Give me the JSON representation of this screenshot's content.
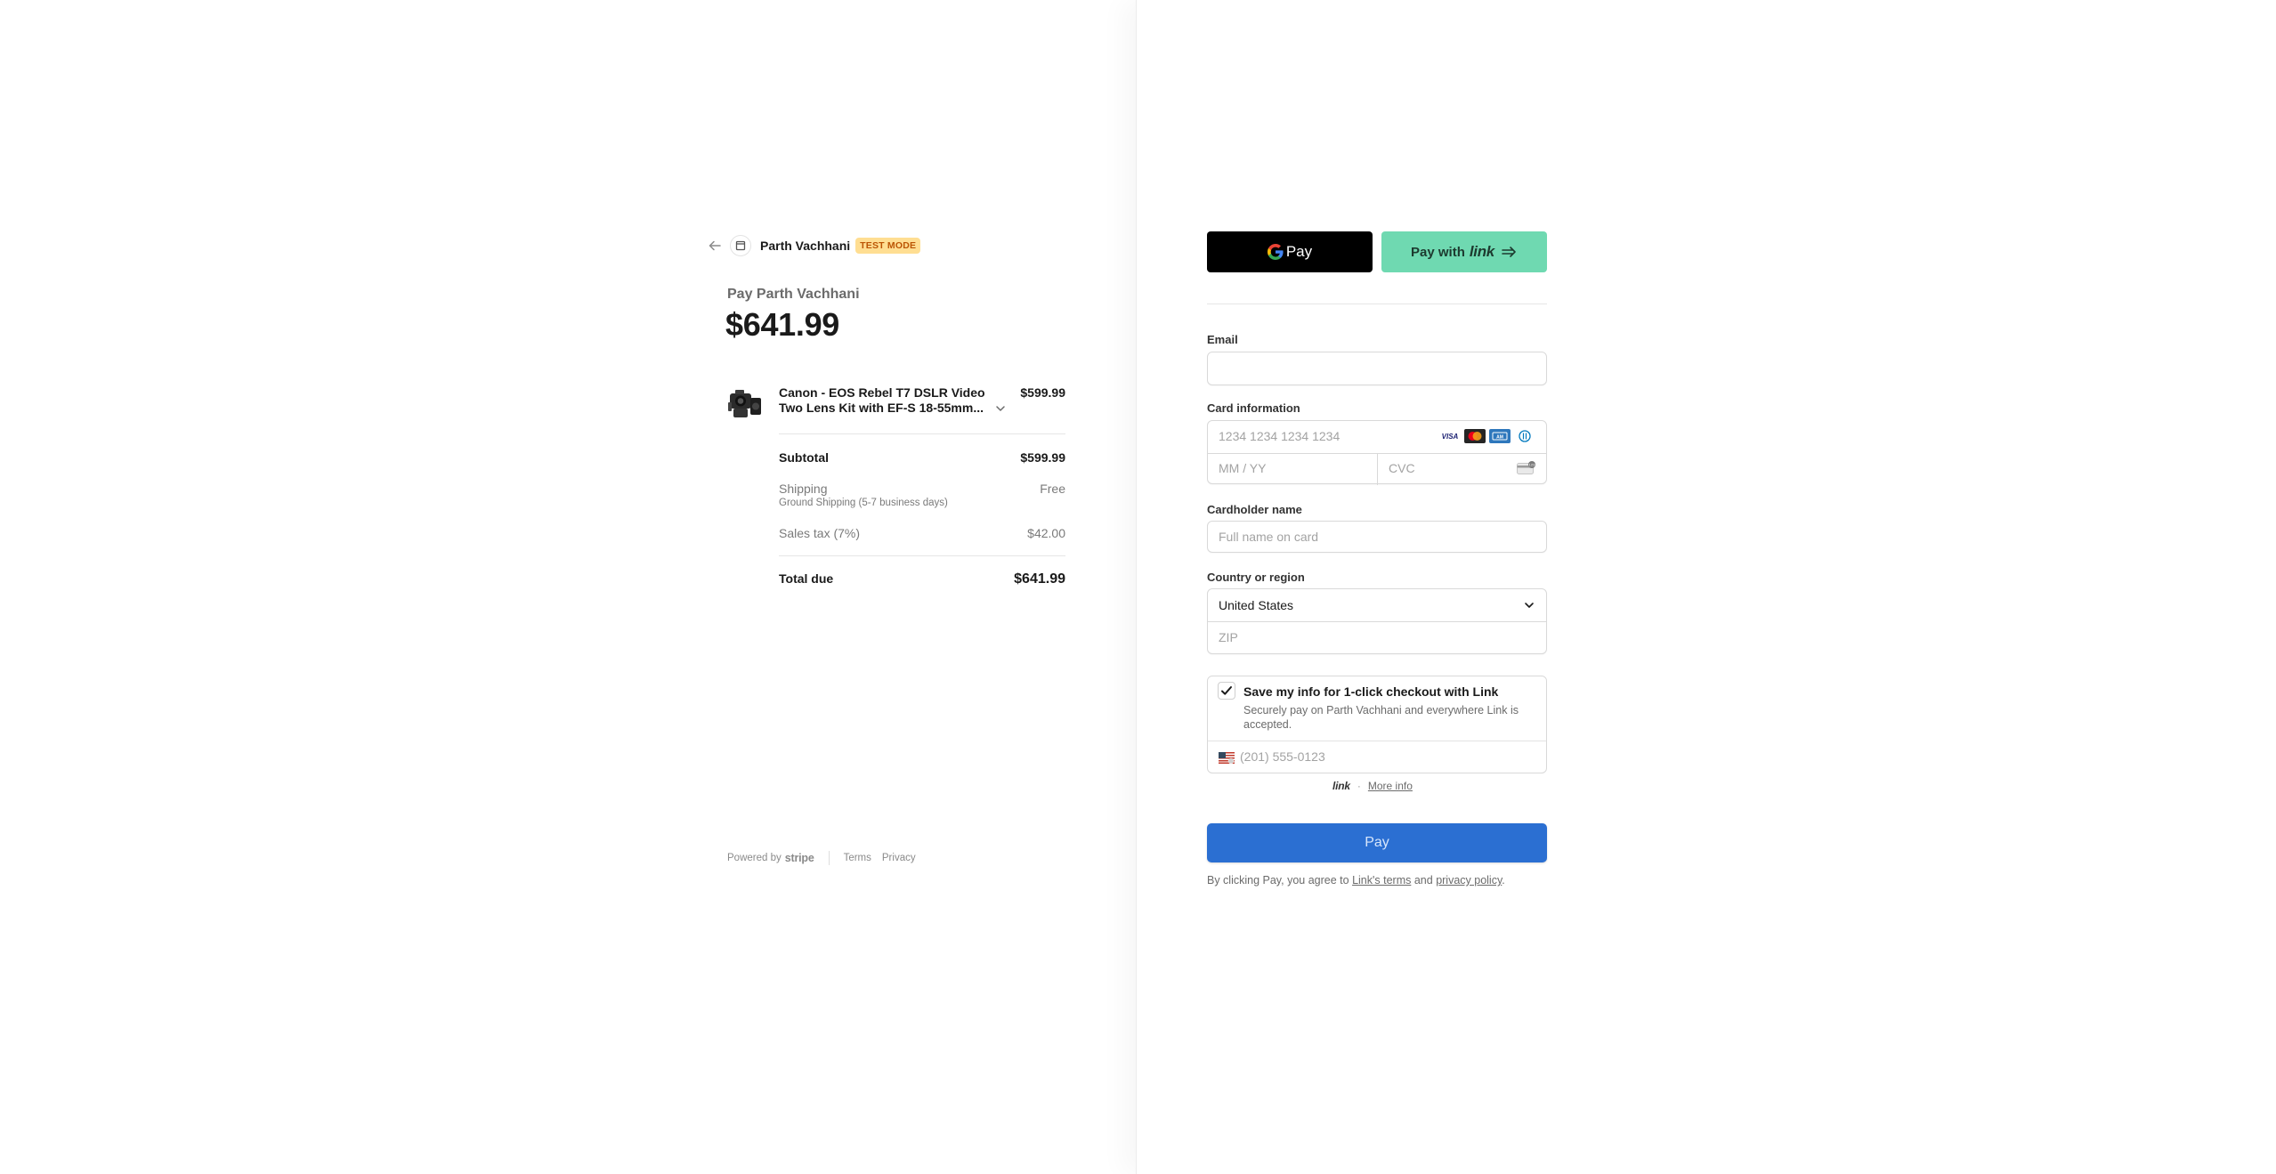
{
  "merchant": {
    "name": "Parth Vachhani",
    "badge": "TEST MODE"
  },
  "summary": {
    "pay_label": "Pay Parth Vachhani",
    "amount": "$641.99",
    "product": {
      "name": "Canon - EOS Rebel T7 DSLR Video Two Lens Kit with EF-S 18-55mm...",
      "price": "$599.99"
    },
    "subtotal_label": "Subtotal",
    "subtotal_value": "$599.99",
    "shipping_label": "Shipping",
    "shipping_value": "Free",
    "shipping_note": "Ground Shipping (5-7 business days)",
    "tax_label": "Sales tax (7%)",
    "tax_value": "$42.00",
    "total_label": "Total due",
    "total_value": "$641.99"
  },
  "footer": {
    "powered_by": "Powered by",
    "stripe": "stripe",
    "terms": "Terms",
    "privacy": "Privacy"
  },
  "wallets": {
    "gpay_label": "Pay",
    "link_prefix": "Pay with",
    "link_word": "link"
  },
  "form": {
    "email_label": "Email",
    "email_value": "",
    "card_label": "Card information",
    "card_number_placeholder": "1234 1234 1234 1234",
    "expiry_placeholder": "MM / YY",
    "cvc_placeholder": "CVC",
    "cardholder_label": "Cardholder name",
    "cardholder_placeholder": "Full name on card",
    "country_label": "Country or region",
    "country_value": "United States",
    "zip_placeholder": "ZIP",
    "card_brands": [
      "visa-icon",
      "mastercard-icon",
      "amex-icon",
      "diners-icon"
    ]
  },
  "link_save": {
    "checked": true,
    "title": "Save my info for 1-click checkout with Link",
    "description": "Securely pay on Parth Vachhani and everywhere Link is accepted.",
    "phone_placeholder": "(201) 555-0123",
    "link_word": "link",
    "dot": "·",
    "more_info": "More info"
  },
  "pay_button": "Pay",
  "terms": {
    "prefix": "By clicking Pay, you agree to",
    "link_terms": "Link's terms",
    "and": "and",
    "privacy": "privacy policy",
    "suffix": "."
  },
  "colors": {
    "accent": "#2b6fd2",
    "link_green": "#6fd9b1",
    "badge_bg": "#ffde92",
    "badge_text": "#bb5504"
  }
}
